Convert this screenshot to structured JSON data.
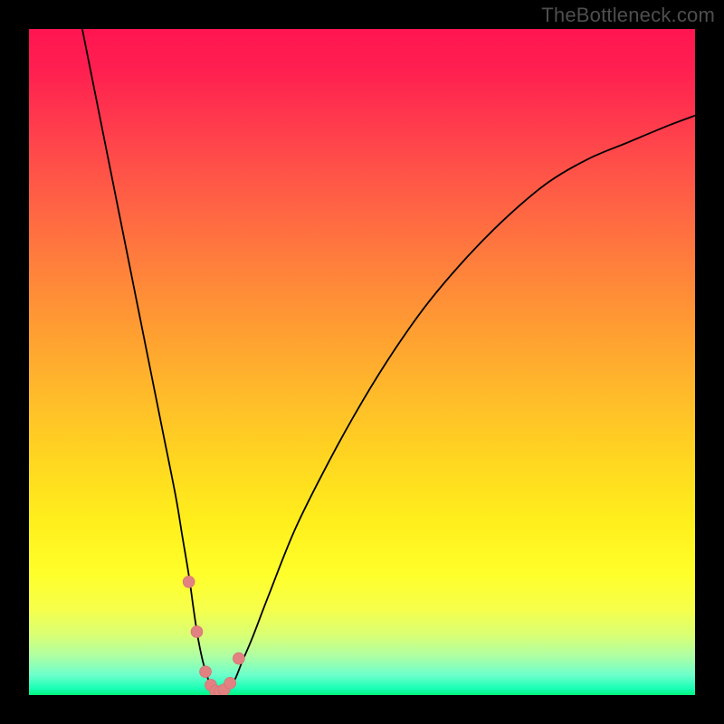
{
  "watermark": "TheBottleneck.com",
  "colors": {
    "background": "#000000",
    "curve_stroke": "#000000",
    "marker_fill": "#e18181",
    "gradient_top": "#ff1551",
    "gradient_bottom": "#00f57e"
  },
  "chart_data": {
    "type": "line",
    "title": "",
    "xlabel": "",
    "ylabel": "",
    "xlim": [
      0,
      100
    ],
    "ylim": [
      0,
      100
    ],
    "grid": false,
    "legend": false,
    "x": [
      8.0,
      10.0,
      12.0,
      14.0,
      16.0,
      18.0,
      20.0,
      22.0,
      23.0,
      24.0,
      24.7,
      25.3,
      26.0,
      26.7,
      27.3,
      28.0,
      28.7,
      29.3,
      30.0,
      31.0,
      32.0,
      33.5,
      36.0,
      40.0,
      45.0,
      50.0,
      55.0,
      60.0,
      66.0,
      72.0,
      78.0,
      84.0,
      90.0,
      96.0,
      100.0
    ],
    "y": [
      100.0,
      90.0,
      80.0,
      70.0,
      60.0,
      50.0,
      40.0,
      30.0,
      24.0,
      18.0,
      13.0,
      9.0,
      5.5,
      3.0,
      1.4,
      0.6,
      0.4,
      0.5,
      1.0,
      2.5,
      5.0,
      8.5,
      15.0,
      25.0,
      35.0,
      44.0,
      52.0,
      59.0,
      66.0,
      72.0,
      77.0,
      80.5,
      83.0,
      85.5,
      87.0
    ],
    "markers": {
      "x": [
        24.0,
        25.2,
        26.5,
        27.3,
        28.0,
        28.7,
        29.3,
        30.2,
        31.5
      ],
      "y": [
        17.0,
        9.5,
        3.5,
        1.5,
        0.6,
        0.5,
        0.8,
        1.8,
        5.5
      ]
    }
  }
}
